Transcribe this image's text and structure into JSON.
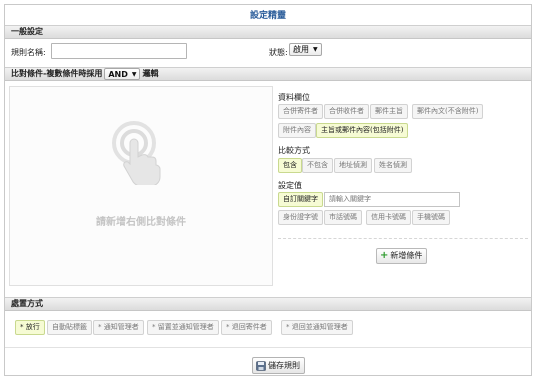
{
  "page_title": "設定精靈",
  "general": {
    "section_title": "一般設定",
    "rule_name_label": "規則名稱:",
    "rule_name_value": "",
    "status_label": "狀態:",
    "status_value": "啟用"
  },
  "compare": {
    "section_prefix": "比對條件-複數條件時採用",
    "logic_value": "AND",
    "section_suffix": "邏輯",
    "hint": "請新增右側比對條件",
    "field_group": {
      "title": "資料欄位",
      "options": [
        "合併寄件者",
        "合併收件者",
        "郵件主旨",
        "郵件內文(不含附件)",
        "附件內容",
        "主旨或郵件內容(包括附件)"
      ],
      "selected": "主旨或郵件內容(包括附件)"
    },
    "method_group": {
      "title": "比較方式",
      "options": [
        "包含",
        "不包含",
        "地址偵測",
        "姓名偵測"
      ],
      "selected": "包含"
    },
    "value_group": {
      "title": "設定值",
      "options": [
        "自訂關鍵字",
        "身份證字號",
        "市話號碼",
        "信用卡號碼",
        "手機號碼"
      ],
      "selected": "自訂關鍵字",
      "keyword_placeholder": "請輸入關鍵字"
    },
    "add_button": "新增條件"
  },
  "process": {
    "section_title": "處置方式",
    "actions": [
      "* 放行",
      "自動貼標籤",
      "* 通知管理者",
      "* 留置並通知管理者",
      "* 退回寄件者",
      "* 退回並通知管理者"
    ],
    "selected": "* 放行"
  },
  "save_button": "儲存規則",
  "icons": {
    "hint": "tap-hand-icon",
    "add": "plus-icon",
    "save": "floppy-disk-icon"
  },
  "colors": {
    "title_blue": "#2a5c9a",
    "active_chip": "#f6fbd4",
    "plus_green": "#2e9b2e"
  }
}
